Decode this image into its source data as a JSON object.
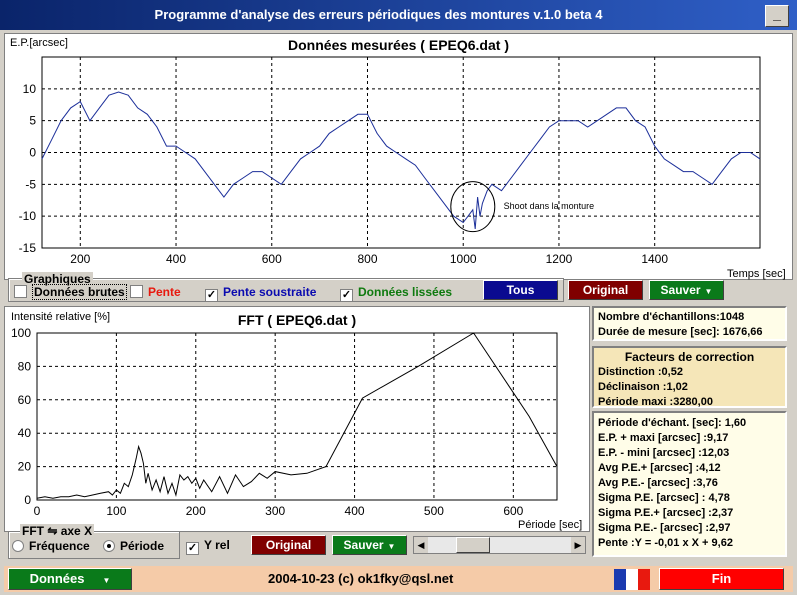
{
  "window": {
    "title": "Programme d'analyse des erreurs périodiques des montures v.1.0 beta 4",
    "minimize_label": "_"
  },
  "top_chart": {
    "chart_data": {
      "type": "line",
      "title": "Données mesurées ( EPEQ6.dat )",
      "ylabel": "E.P.[arcsec]",
      "xlabel": "Temps [sec]",
      "xlim": [
        120,
        1620
      ],
      "ylim": [
        -15,
        15
      ],
      "x_ticks": [
        200,
        400,
        600,
        800,
        1000,
        1200,
        1400
      ],
      "y_ticks": [
        10,
        5,
        0,
        -5,
        -10,
        -15
      ],
      "grid": true,
      "series": [
        {
          "color": "#1c2f9a",
          "x": [
            120,
            140,
            160,
            180,
            200,
            220,
            240,
            260,
            280,
            300,
            320,
            340,
            360,
            380,
            400,
            420,
            440,
            460,
            480,
            500,
            520,
            540,
            560,
            580,
            600,
            620,
            640,
            660,
            680,
            700,
            720,
            740,
            760,
            780,
            800,
            820,
            840,
            860,
            880,
            900,
            920,
            940,
            960,
            980,
            1000,
            1010,
            1020,
            1025,
            1030,
            1035,
            1040,
            1050,
            1060,
            1080,
            1100,
            1120,
            1140,
            1160,
            1180,
            1200,
            1220,
            1240,
            1260,
            1280,
            1300,
            1320,
            1340,
            1360,
            1380,
            1400,
            1420,
            1440,
            1460,
            1480,
            1500,
            1520,
            1540,
            1560,
            1580,
            1600,
            1620
          ],
          "y": [
            -1,
            2,
            5,
            7,
            8,
            5,
            7,
            9,
            9.5,
            9,
            7,
            6,
            4,
            1,
            1,
            0,
            -1,
            -3,
            -5,
            -7,
            -5,
            -4,
            -3,
            -3,
            -4,
            -5,
            -3,
            -1,
            0,
            1,
            3,
            4,
            5,
            6,
            6,
            3,
            1,
            0,
            -1,
            -2,
            -4,
            -6,
            -8,
            -10,
            -11,
            -10,
            -9,
            -12,
            -7,
            -10,
            -8,
            -6,
            -5,
            -6,
            -4,
            -2,
            0,
            2,
            4,
            5,
            5,
            5,
            4,
            5,
            6,
            7,
            7,
            5,
            4,
            1,
            -1,
            -2,
            -3,
            -3,
            -4,
            -5,
            -3,
            -1,
            0,
            0,
            -1
          ]
        }
      ],
      "annotation": {
        "text": "Shoot dans la monture",
        "x": 1030,
        "y": -8.5
      }
    }
  },
  "graphiques": {
    "group_label": "Graphiques",
    "items": [
      {
        "label": "Données brutes",
        "checked": false,
        "color": "#000000"
      },
      {
        "label": "Pente",
        "checked": false,
        "color": "#e8190f"
      },
      {
        "label": "Pente soustraite",
        "checked": true,
        "color": "#0a0ab0"
      },
      {
        "label": "Données lissées",
        "checked": true,
        "color": "#0f7a0f"
      }
    ],
    "buttons": {
      "tous": "Tous",
      "original": "Original",
      "sauver": "Sauver"
    }
  },
  "fft_chart": {
    "chart_data": {
      "type": "line",
      "title": "FFT ( EPEQ6.dat )",
      "ylabel": "Intensité relative [%]",
      "xlabel": "Période [sec]",
      "xlim": [
        0,
        655
      ],
      "ylim": [
        0,
        100
      ],
      "x_ticks": [
        0,
        100,
        200,
        300,
        400,
        500,
        600
      ],
      "y_ticks": [
        100,
        80,
        60,
        40,
        20,
        0
      ],
      "grid": true,
      "series": [
        {
          "color": "#000000",
          "x": [
            0,
            10,
            20,
            30,
            40,
            50,
            60,
            70,
            80,
            90,
            95,
            100,
            105,
            110,
            115,
            120,
            125,
            128,
            131,
            134,
            137,
            140,
            145,
            150,
            155,
            160,
            165,
            170,
            175,
            180,
            185,
            190,
            195,
            200,
            205,
            210,
            220,
            230,
            240,
            250,
            260,
            270,
            280,
            290,
            300,
            320,
            340,
            364,
            410,
            480,
            550,
            620,
            655
          ],
          "y": [
            1,
            2,
            1,
            2,
            2,
            3,
            2,
            3,
            4,
            5,
            3,
            6,
            4,
            10,
            8,
            15,
            25,
            32,
            28,
            22,
            10,
            16,
            6,
            12,
            5,
            14,
            4,
            10,
            3,
            15,
            12,
            14,
            10,
            13,
            7,
            12,
            5,
            14,
            4,
            15,
            8,
            11,
            16,
            13,
            17,
            15,
            16,
            20,
            61,
            80,
            100,
            50,
            20
          ]
        }
      ]
    }
  },
  "fft_controls": {
    "axis_group_label": "FFT ⇋ axe X",
    "frequence": "Fréquence",
    "periode": "Période",
    "yrel": "Y rel",
    "original": "Original",
    "sauver": "Sauver"
  },
  "info": {
    "samples": "Nombre d'échantillons:1048",
    "duration": "Durée de mesure [sec]: 1676,66"
  },
  "correction": {
    "title": "Facteurs de correction",
    "distinction": "Distinction :0,52",
    "declinaison": "Déclinaison :1,02",
    "periode_maxi": "Période maxi :3280,00"
  },
  "stats": {
    "items": [
      "Période d'échant. [sec]: 1,60",
      "E.P. + maxi [arcsec] :9,17",
      "E.P. - mini [arcsec] :12,03",
      "Avg P.E.+ [arcsec] :4,12",
      "Avg P.E.- [arcsec] :3,76",
      "Sigma P.E. [arcsec] : 4,78",
      "Sigma P.E.+ [arcsec] :2,37",
      "Sigma P.E.- [arcsec] :2,97",
      "Pente :Y = -0,01 x X + 9,62"
    ]
  },
  "statusbar": {
    "donnees": "Données",
    "credits": "2004-10-23 (c) ok1fky@qsl.net",
    "fin": "Fin"
  },
  "colors": {
    "blue_btn": "#0a0a90",
    "red_btn": "#800000",
    "green_btn": "#0a7a1a",
    "fin": "#ff0000",
    "title": "#0a246a"
  }
}
